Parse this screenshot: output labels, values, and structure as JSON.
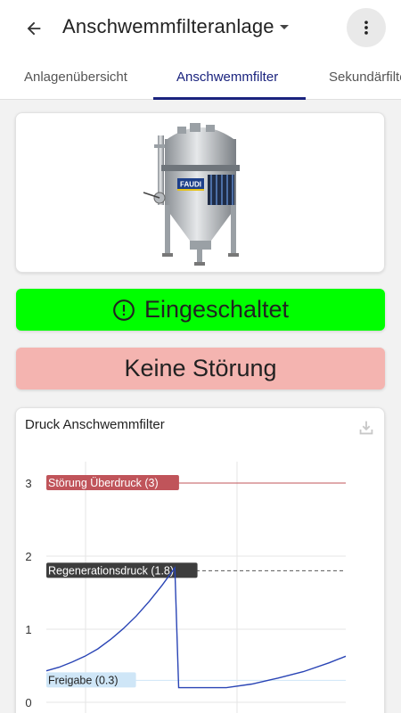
{
  "header": {
    "title": "Anschwemmfilteranlage",
    "back_icon": "arrow-back-icon",
    "dropdown_icon": "caret-down-icon",
    "menu_icon": "more-vert-icon"
  },
  "tabs": [
    {
      "label": "Anlagenübersicht",
      "active": false
    },
    {
      "label": "Anschwemmfilter",
      "active": true
    },
    {
      "label": "Sekundärfilter",
      "active": false
    }
  ],
  "product_image": {
    "brand": "FAUDI"
  },
  "status": {
    "running_label": "Eingeschaltet",
    "running_color": "#00ff00",
    "running_icon": "alert-circle-icon",
    "error_label": "Keine Störung",
    "error_color": "#f4b4b0"
  },
  "chart_data": {
    "type": "line",
    "title": "Druck Anschwemmfilter",
    "ylim": [
      0,
      3.3
    ],
    "y_ticks": [
      "0",
      "1",
      "2",
      "3"
    ],
    "series": [
      {
        "values": [
          [
            0,
            0.43
          ],
          [
            1,
            0.48
          ],
          [
            2,
            0.55
          ],
          [
            3,
            0.63
          ],
          [
            4,
            0.73
          ],
          [
            5,
            0.86
          ],
          [
            6,
            1.01
          ],
          [
            7,
            1.18
          ],
          [
            8,
            1.38
          ],
          [
            9,
            1.6
          ],
          [
            10,
            1.84
          ],
          [
            10.3,
            0.2
          ],
          [
            14,
            0.2
          ],
          [
            16,
            0.25
          ],
          [
            18,
            0.33
          ],
          [
            20,
            0.42
          ],
          [
            22,
            0.54
          ],
          [
            23.3,
            0.63
          ]
        ]
      }
    ],
    "thresholds": [
      {
        "label": "Störung Überdruck (3)",
        "value": 3,
        "color": "#c0545a",
        "bg": "#c0545a",
        "text_color": "#ffffff"
      },
      {
        "label": "Regenerationsdruck (1.8)",
        "value": 1.8,
        "color": "#555555",
        "bg": "#3d3d3d",
        "text_color": "#ffffff"
      },
      {
        "label": "Freigabe (0.3)",
        "value": 0.3,
        "color": "#cfe6f7",
        "bg": "#cfe6f7",
        "text_color": "#222222"
      }
    ],
    "line_color": "#2944b5",
    "grid": true
  }
}
